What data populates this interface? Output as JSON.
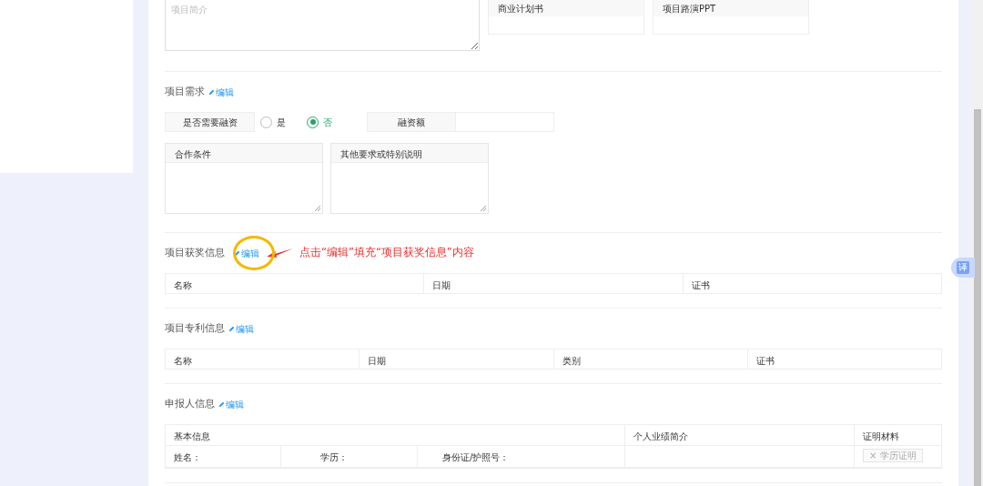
{
  "intro": {
    "placeholder": "项目简介"
  },
  "attachments": [
    {
      "label": "商业计划书"
    },
    {
      "label": "项目路演PPT"
    }
  ],
  "sections": [
    {
      "kind": "demand",
      "title": "项目需求",
      "edit": "编辑",
      "financing": {
        "label": "是否需要融资",
        "options": [
          {
            "label": "是",
            "selected": false
          },
          {
            "label": "否",
            "selected": true
          }
        ]
      },
      "amount": {
        "label": "融资额"
      },
      "textareas": [
        {
          "label": "合作条件"
        },
        {
          "label": "其他要求或特别说明"
        }
      ]
    },
    {
      "kind": "table",
      "title": "项目获奖信息",
      "edit": "编辑",
      "columns": [
        "名称",
        "日期",
        "证书"
      ],
      "annotation": {
        "text": "点击“编辑”填充“项目获奖信息”内容"
      }
    },
    {
      "kind": "table",
      "title": "项目专利信息",
      "edit": "编辑",
      "columns": [
        "名称",
        "日期",
        "类别",
        "证书"
      ]
    },
    {
      "kind": "applicant",
      "title": "申报人信息",
      "edit": "编辑",
      "groups": [
        "基本信息",
        "个人业绩简介",
        "证明材料"
      ],
      "fields": [
        "姓名：",
        "学历：",
        "身份证/护照号："
      ],
      "proof": {
        "icon": "×",
        "label": "学历证明"
      }
    }
  ],
  "translate_button": "译"
}
